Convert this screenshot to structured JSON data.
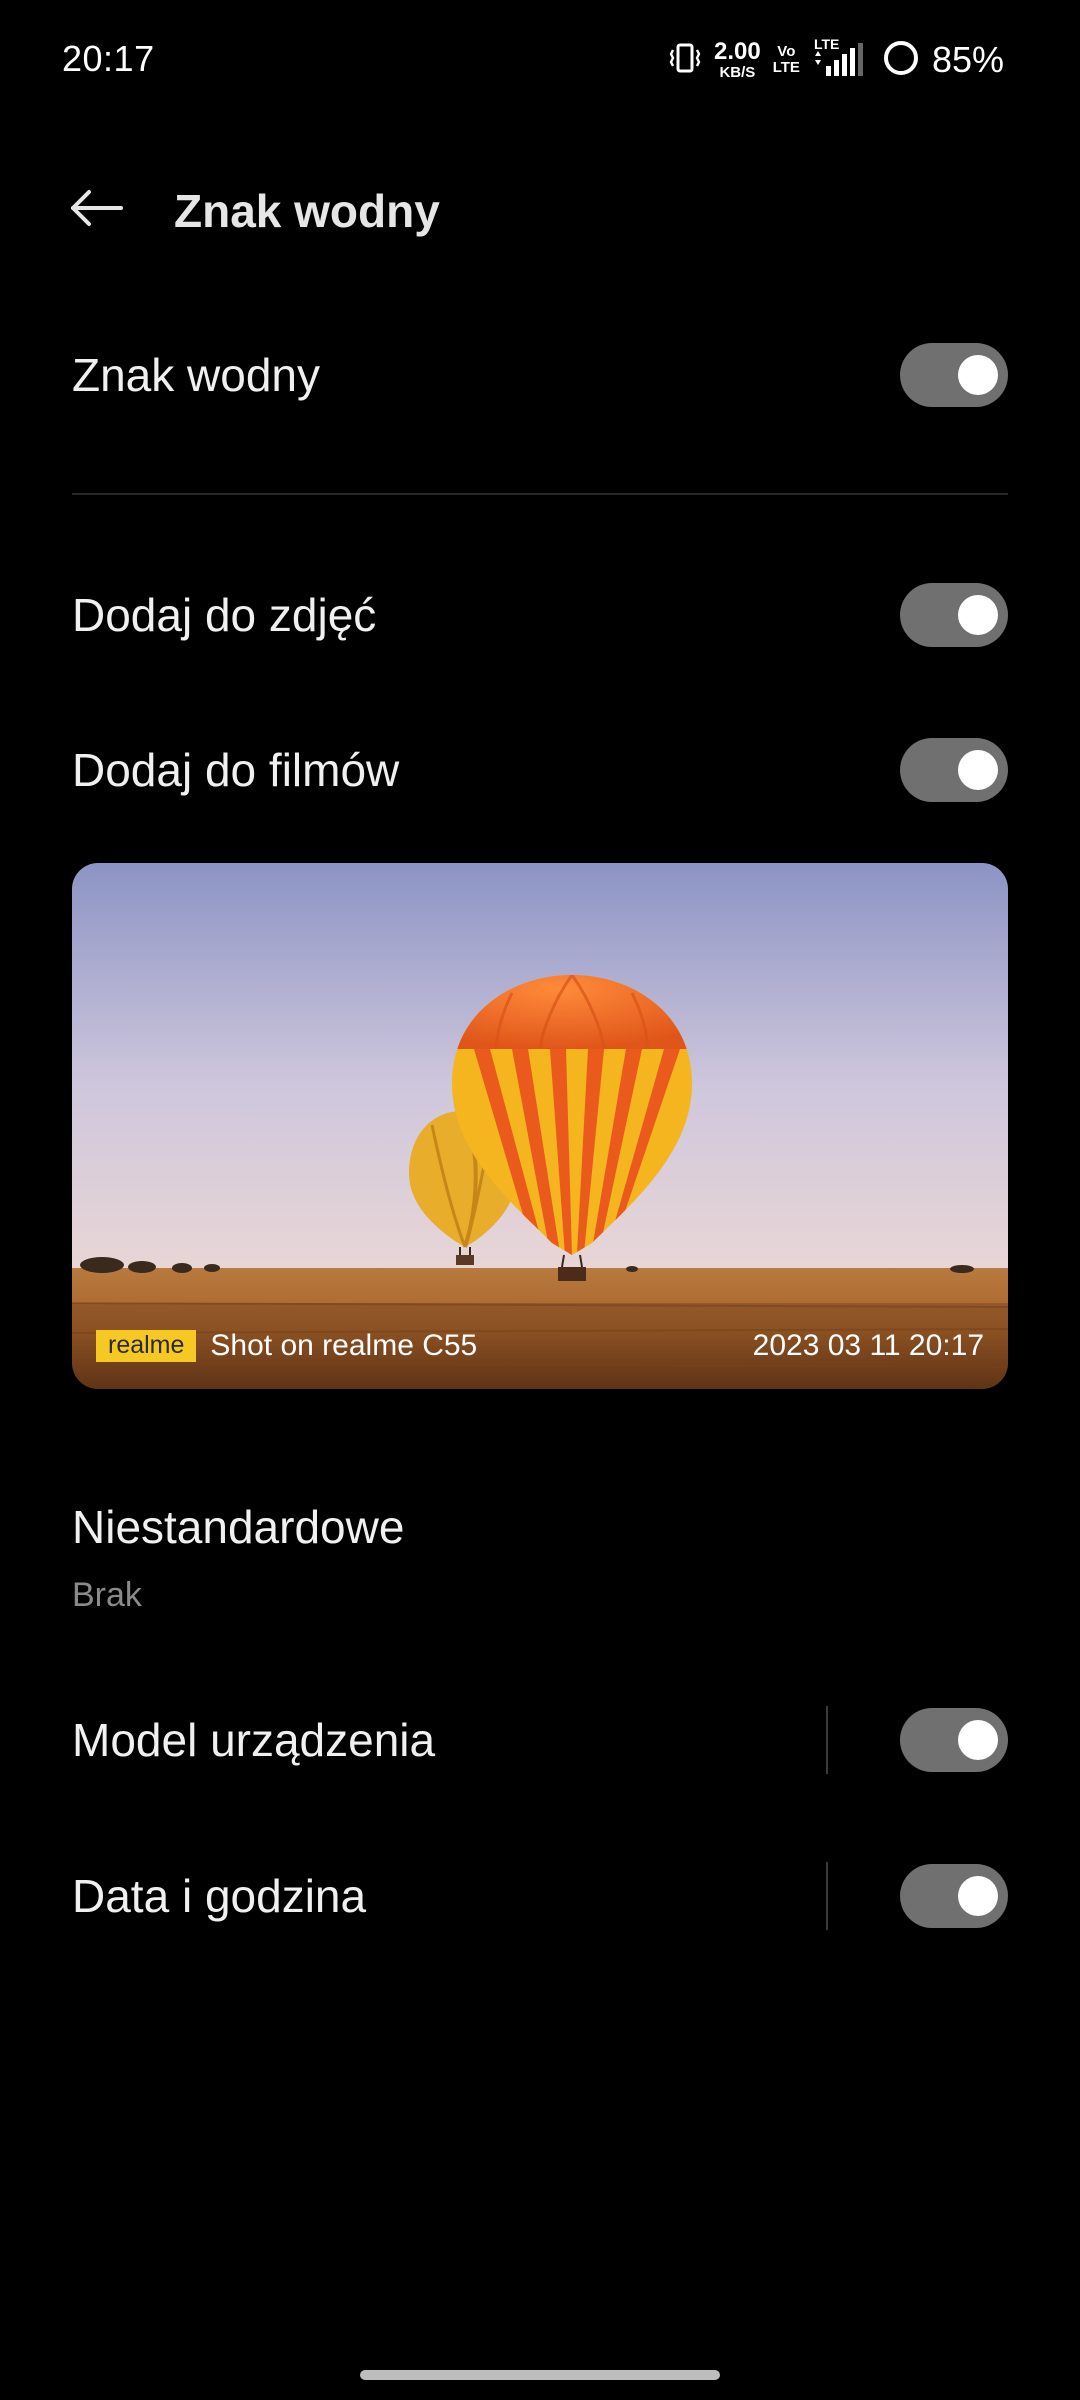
{
  "status_bar": {
    "time": "20:17",
    "net_speed_value": "2.00",
    "net_speed_unit": "KB/S",
    "volte_top": "Vo",
    "volte_bottom": "LTE",
    "lte_label": "LTE",
    "battery_percent": "85%"
  },
  "header": {
    "title": "Znak wodny"
  },
  "settings": {
    "watermark_label": "Znak wodny",
    "watermark_on": true,
    "add_to_photos_label": "Dodaj do zdjęć",
    "add_to_photos_on": true,
    "add_to_videos_label": "Dodaj do filmów",
    "add_to_videos_on": true
  },
  "preview": {
    "brand_logo": "realme",
    "shot_text": "Shot on realme C55",
    "datetime": "2023 03 11 20:17",
    "colors": {
      "sky_top": "#8c94c4",
      "sky_bottom": "#e9d6d6",
      "ground": "#a8632a",
      "balloon_orange": "#f26a1f",
      "balloon_yellow": "#f4b51e",
      "logo_bg": "#f6c823"
    }
  },
  "custom": {
    "title": "Niestandardowe",
    "value": "Brak"
  },
  "info_toggles": {
    "device_model_label": "Model urządzenia",
    "device_model_on": true,
    "date_time_label": "Data i godzina",
    "date_time_on": true
  },
  "colors": {
    "background": "#000000",
    "toggle_track": "#707070",
    "toggle_knob": "#ffffff",
    "secondary_text": "#8a8a8a"
  }
}
